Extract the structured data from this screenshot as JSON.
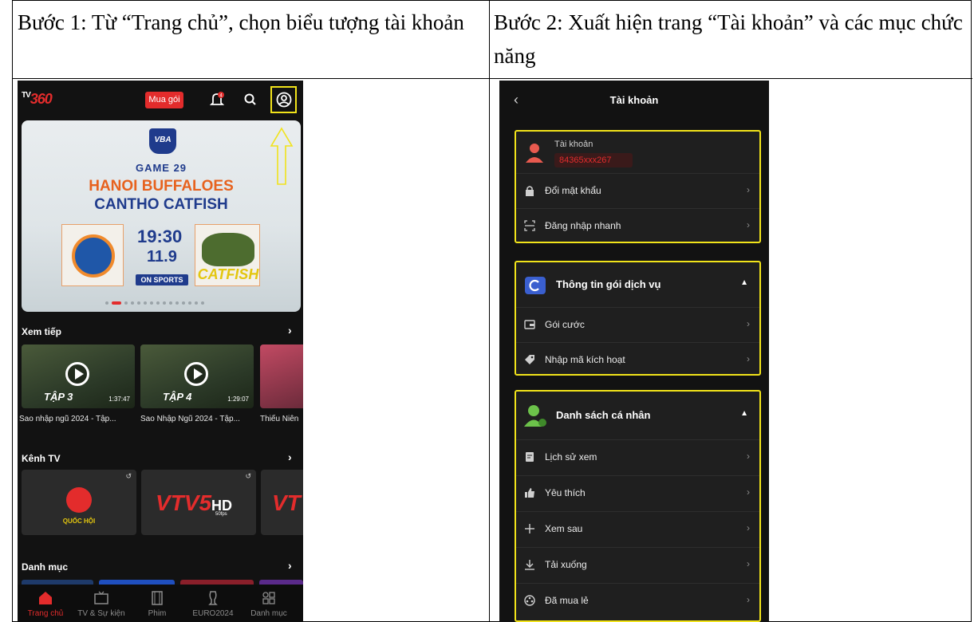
{
  "doc": {
    "step1_text": "Bước 1: Từ “Trang chủ”, chọn biểu tượng tài khoản",
    "step2_text": "Bước 2: Xuất hiện trang “Tài khoản” và các mục chức năng"
  },
  "phone1": {
    "logo_tv": "TV",
    "logo_num": "360",
    "buy_button": "Mua gói",
    "notification_count": "4",
    "banner": {
      "badge": "VBA",
      "game": "GAME 29",
      "team1": "HANOI BUFFALOES",
      "team2": "CANTHO CATFISH",
      "time": "19:30",
      "date": "11.9",
      "broadcaster": "ON SPORTS",
      "team2_logo_text": "CATFISH"
    },
    "continue_watching": {
      "title": "Xem tiếp",
      "arrow": "›",
      "items": [
        {
          "episode": "TẬP 3",
          "duration": "1:37:47",
          "caption": "Sao nhập ngũ 2024 - Tập..."
        },
        {
          "episode": "TẬP 4",
          "duration": "1:29:07",
          "caption": "Sao Nhập Ngũ 2024 - Tập..."
        },
        {
          "caption": "Thiếu Niên"
        }
      ]
    },
    "tv_channels": {
      "title": "Kênh TV",
      "arrow": "›",
      "channels": [
        {
          "name": "QUỐC HỘI"
        },
        {
          "name": "VTV5",
          "quality": "HD",
          "fps": "50fps"
        },
        {
          "name": "VT"
        }
      ]
    },
    "categories": {
      "title": "Danh mục",
      "arrow": "›"
    },
    "nav": [
      {
        "label": "Trang chủ",
        "icon": "home-icon"
      },
      {
        "label": "TV & Sự kiện",
        "icon": "tv-icon"
      },
      {
        "label": "Phim",
        "icon": "film-icon"
      },
      {
        "label": "EURO2024",
        "icon": "trophy-icon"
      },
      {
        "label": "Danh mục",
        "icon": "grid-icon"
      }
    ],
    "colors": {
      "accent": "#e32c2c",
      "highlight": "#f1e31a",
      "background": "#121212"
    }
  },
  "phone2": {
    "back": "‹",
    "title": "Tài khoản",
    "account": {
      "label": "Tài khoản",
      "phone": "84365xxx267",
      "rows": [
        {
          "label": "Đổi mật khẩu",
          "icon": "lock-icon"
        },
        {
          "label": "Đăng nhập nhanh",
          "icon": "scan-icon"
        }
      ]
    },
    "service": {
      "title": "Thông tin gói dịch vụ",
      "rows": [
        {
          "label": "Gói cước",
          "icon": "wallet-icon"
        },
        {
          "label": "Nhập mã kích hoạt",
          "icon": "tag-icon"
        }
      ]
    },
    "personal": {
      "title": "Danh sách cá nhân",
      "rows": [
        {
          "label": "Lịch sử xem",
          "icon": "history-icon"
        },
        {
          "label": "Yêu thích",
          "icon": "thumbs-up-icon"
        },
        {
          "label": "Xem sau",
          "icon": "plus-icon"
        },
        {
          "label": "Tải xuống",
          "icon": "download-icon"
        },
        {
          "label": "Đã mua lẻ",
          "icon": "film-reel-icon"
        }
      ]
    },
    "chevron": "›",
    "caret": "▲"
  }
}
